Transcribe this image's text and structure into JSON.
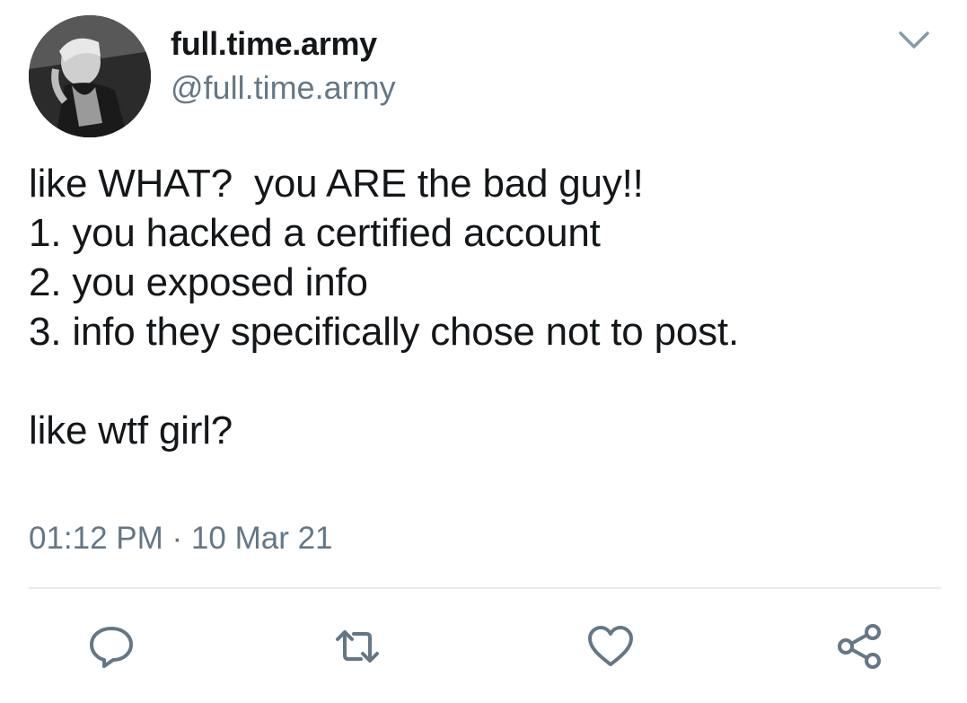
{
  "user": {
    "display_name": "full.time.army",
    "handle": "@full.time.army",
    "avatar_icon": "profile-photo"
  },
  "tweet": {
    "text": "like WHAT?  you ARE the bad guy!!\n1. you hacked a certified account\n2. you exposed info\n3. info they specifically chose not to post.\n\nlike wtf girl?",
    "timestamp": "01:12 PM · 10 Mar 21"
  },
  "actions": {
    "reply_icon": "reply-icon",
    "retweet_icon": "retweet-icon",
    "like_icon": "heart-icon",
    "share_icon": "share-icon"
  },
  "colors": {
    "text_primary": "#14171a",
    "text_secondary": "#657786",
    "divider": "#e6ecf0"
  }
}
